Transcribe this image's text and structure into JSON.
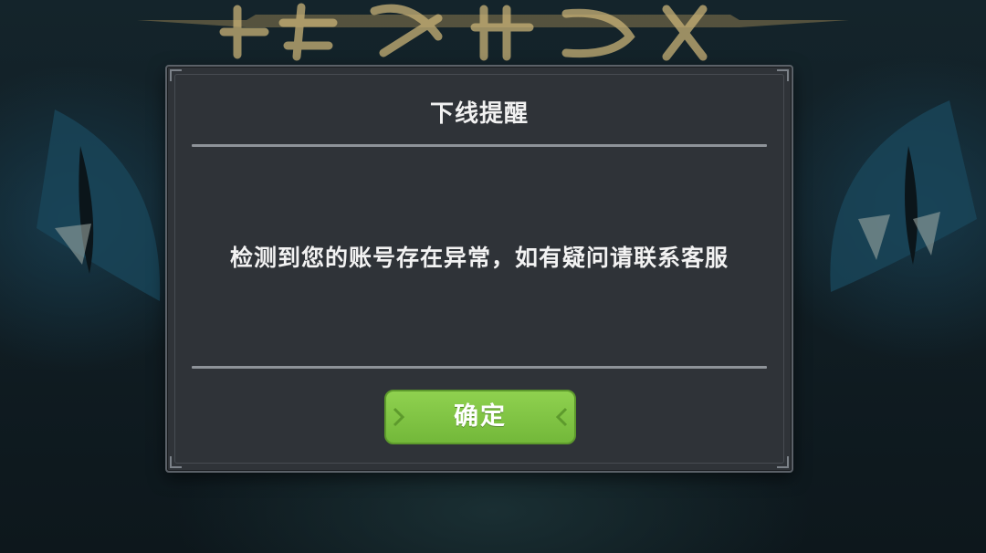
{
  "dialog": {
    "title": "下线提醒",
    "message": "检测到您的账号存在异常，如有疑问请联系客服",
    "confirm_label": "确定"
  },
  "colors": {
    "dialog_bg": "#2f3338",
    "button_green": "#7ec443",
    "text": "#f1f1f1"
  }
}
